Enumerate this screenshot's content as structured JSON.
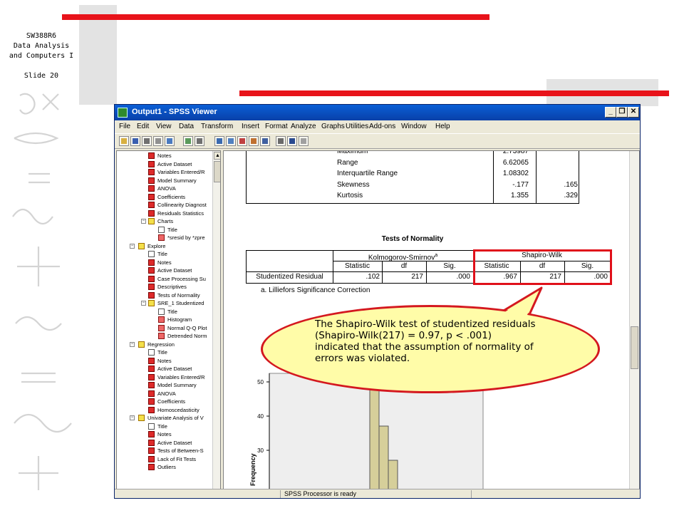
{
  "slide": {
    "course_code": "SW388R6",
    "course_name_1": "Data Analysis",
    "course_name_2": "and Computers I",
    "slide_number": "Slide 20"
  },
  "window": {
    "title": "Output1 - SPSS Viewer",
    "menu": [
      "File",
      "Edit",
      "View",
      "Data",
      "Transform",
      "Insert",
      "Format",
      "Analyze",
      "Graphs",
      "Utilities",
      "Add-ons",
      "Window",
      "Help"
    ],
    "status": "SPSS Processor is ready"
  },
  "outline": {
    "items": [
      {
        "label": "Notes",
        "icon": "log"
      },
      {
        "label": "Active Dataset",
        "icon": "log"
      },
      {
        "label": "Variables Entered/R",
        "icon": "log"
      },
      {
        "label": "Model Summary",
        "icon": "log"
      },
      {
        "label": "ANOVA",
        "icon": "log"
      },
      {
        "label": "Coefficients",
        "icon": "log"
      },
      {
        "label": "Collinearity Diagnost",
        "icon": "log"
      },
      {
        "label": "Residuals Statistics",
        "icon": "log"
      },
      {
        "label": "Charts",
        "icon": "book"
      },
      {
        "label": "Title",
        "icon": "doc"
      },
      {
        "label": "*sresid by *zpre",
        "icon": "chart"
      },
      {
        "label": "Explore",
        "icon": "book"
      },
      {
        "label": "Title",
        "icon": "doc"
      },
      {
        "label": "Notes",
        "icon": "log"
      },
      {
        "label": "Active Dataset",
        "icon": "log"
      },
      {
        "label": "Case Processing Su",
        "icon": "log"
      },
      {
        "label": "Descriptives",
        "icon": "log"
      },
      {
        "label": "Tests of Normality",
        "icon": "log"
      },
      {
        "label": "SRE_1  Studentized",
        "icon": "book"
      },
      {
        "label": "Title",
        "icon": "doc"
      },
      {
        "label": "Histogram",
        "icon": "chart"
      },
      {
        "label": "Normal Q-Q Plot",
        "icon": "chart"
      },
      {
        "label": "Detrended Norm",
        "icon": "chart"
      },
      {
        "label": "Regression",
        "icon": "book"
      },
      {
        "label": "Title",
        "icon": "doc"
      },
      {
        "label": "Notes",
        "icon": "log"
      },
      {
        "label": "Active Dataset",
        "icon": "log"
      },
      {
        "label": "Variables Entered/R",
        "icon": "log"
      },
      {
        "label": "Model Summary",
        "icon": "log"
      },
      {
        "label": "ANOVA",
        "icon": "log"
      },
      {
        "label": "Coefficients",
        "icon": "log"
      },
      {
        "label": "Homoscedasticity",
        "icon": "log"
      },
      {
        "label": "Univariate Analysis of V",
        "icon": "book"
      },
      {
        "label": "Title",
        "icon": "doc"
      },
      {
        "label": "Notes",
        "icon": "log"
      },
      {
        "label": "Active Dataset",
        "icon": "log"
      },
      {
        "label": "Tests of Between-S",
        "icon": "log"
      },
      {
        "label": "Lack of Fit Tests",
        "icon": "log"
      },
      {
        "label": "Outliers",
        "icon": "log"
      }
    ]
  },
  "descriptives": {
    "rows": [
      {
        "label": "Maximum",
        "statistic": "2.73987",
        "std_error": ""
      },
      {
        "label": "Range",
        "statistic": "6.62065",
        "std_error": ""
      },
      {
        "label": "Interquartile Range",
        "statistic": "1.08302",
        "std_error": ""
      },
      {
        "label": "Skewness",
        "statistic": "-.177",
        "std_error": ".165"
      },
      {
        "label": "Kurtosis",
        "statistic": "1.355",
        "std_error": ".329"
      }
    ]
  },
  "normality": {
    "title": "Tests of Normality",
    "group_ks": "Kolmogorov-Smirnov",
    "group_ks_sup": "a",
    "group_sw": "Shapiro-Wilk",
    "col_statistic": "Statistic",
    "col_df": "df",
    "col_sig": "Sig.",
    "row_label": "Studentized Residual",
    "ks_statistic": ".102",
    "ks_df": "217",
    "ks_sig": ".000",
    "sw_statistic": ".967",
    "sw_df": "217",
    "sw_sig": ".000",
    "footnote": "a. Lilliefors Significance Correction"
  },
  "histogram": {
    "y_label": "Frequency",
    "ticks": [
      "50",
      "40",
      "30"
    ]
  },
  "callout": {
    "text": "The Shapiro-Wilk test of studentized residuals (Shapiro-Wilk(217) = 0.97, p < .001) indicated that the assumption of normality of errors was violated."
  },
  "colors": {
    "accent_red": "#e8131a",
    "callout_fill": "#fffca8",
    "titlebar": "#0a5fd6"
  }
}
